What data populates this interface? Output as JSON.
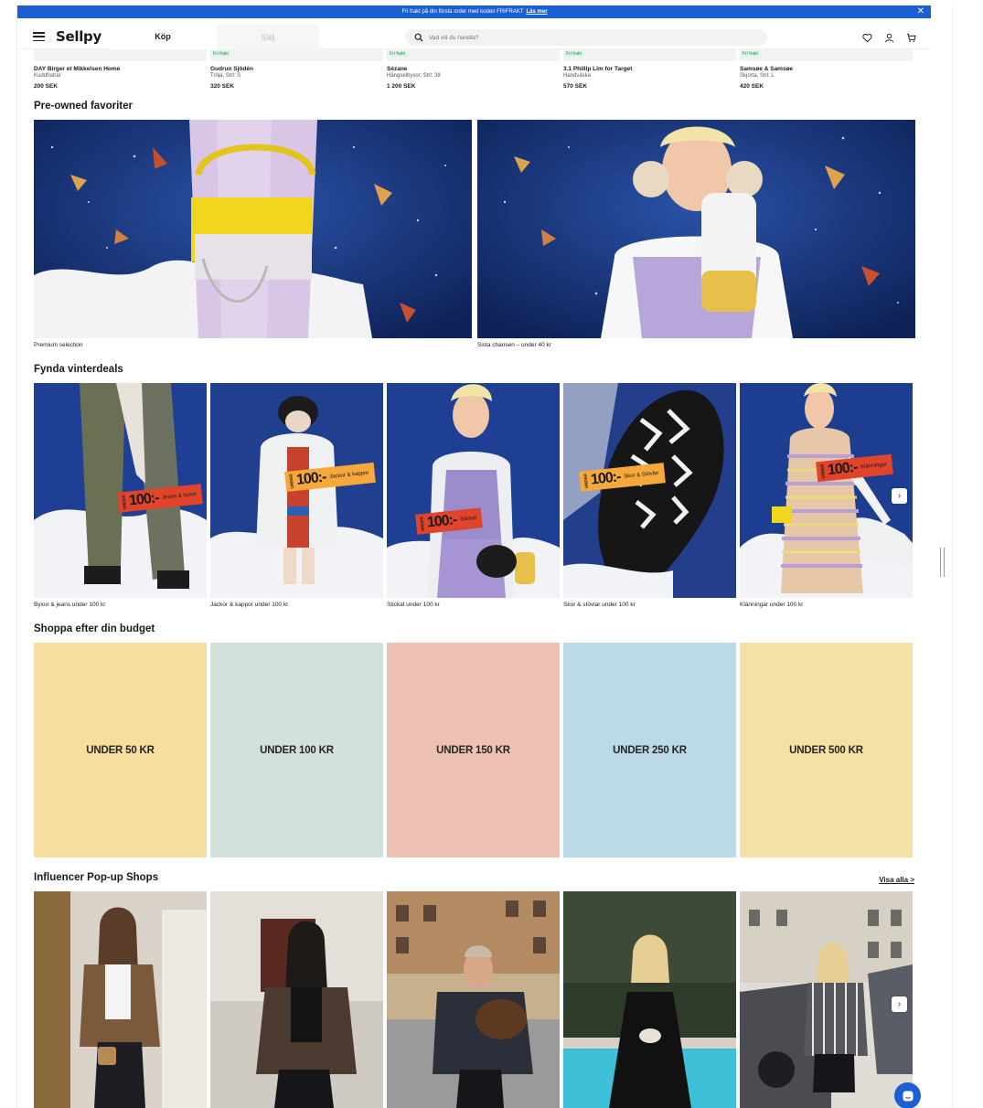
{
  "promo": {
    "text": "Fri frakt på din första order med koden FRIFRAKT",
    "link": "Läs mer"
  },
  "header": {
    "logo": "Sellpy",
    "tabs": {
      "buy": "Köp",
      "sell": "Sälj"
    },
    "search_placeholder": "Vad vill du handla?"
  },
  "prev_items": [
    {
      "brand": "DAY Birger et Mikkelsen Home",
      "desc": "Kuddfodral",
      "price": "200 SEK",
      "badge": ""
    },
    {
      "brand": "Gudrun Sjödén",
      "desc": "Tröja, Strl: S",
      "price": "320 SEK",
      "badge": "Fri frakt"
    },
    {
      "brand": "Sézane",
      "desc": "Hängselbyxor, Strl: 38",
      "price": "1 200 SEK",
      "badge": "Fri frakt"
    },
    {
      "brand": "3.1 Phillip Lim for Target",
      "desc": "Handväska",
      "price": "570 SEK",
      "badge": "Fri frakt"
    },
    {
      "brand": "Samsøe & Samsøe",
      "desc": "Skjorta, Strl: L",
      "price": "420 SEK",
      "badge": "Fri frakt"
    }
  ],
  "preowned": {
    "title": "Pre-owned favoriter",
    "items": [
      {
        "caption": "Premium selection"
      },
      {
        "caption": "Sista chansen – under 40 kr"
      }
    ]
  },
  "winter": {
    "title": "Fynda vinterdeals",
    "items": [
      {
        "caption": "Byxor & jeans under 100 kr",
        "tag_price": "100:-",
        "tag_small": "UNDER",
        "tag_label": "Jeans & byxor"
      },
      {
        "caption": "Jackor & kappor under 100 kr",
        "tag_price": "100:-",
        "tag_small": "UNDER",
        "tag_label": "Jackor & kappor"
      },
      {
        "caption": "Stickat under 100 kr",
        "tag_price": "100:-",
        "tag_small": "UNDER",
        "tag_label": "Stickat"
      },
      {
        "caption": "Skor & stövlar under 100 kr",
        "tag_price": "100:-",
        "tag_small": "UNDER",
        "tag_label": "Skor & Stövlar"
      },
      {
        "caption": "Klänningar under 100 kr",
        "tag_price": "100:-",
        "tag_small": "UNDER",
        "tag_label": "Klänningar"
      }
    ]
  },
  "budget": {
    "title": "Shoppa efter din budget",
    "items": [
      {
        "label": "UNDER 50 KR",
        "color": "#f5dea0"
      },
      {
        "label": "UNDER 100 KR",
        "color": "#d2e2da"
      },
      {
        "label": "UNDER 150 KR",
        "color": "#eec2b2"
      },
      {
        "label": "UNDER 250 KR",
        "color": "#bcd9e8"
      },
      {
        "label": "UNDER 500 KR",
        "color": "#f5e1a3"
      }
    ]
  },
  "influencer": {
    "title": "Influencer Pop-up Shops",
    "see_all": "Visa alla >"
  },
  "colors": {
    "brand_blue": "#1b5fd1",
    "tag_red": "#e0442a",
    "tag_orange": "#f6a83a",
    "snow_blue": "#1f3f8c"
  }
}
